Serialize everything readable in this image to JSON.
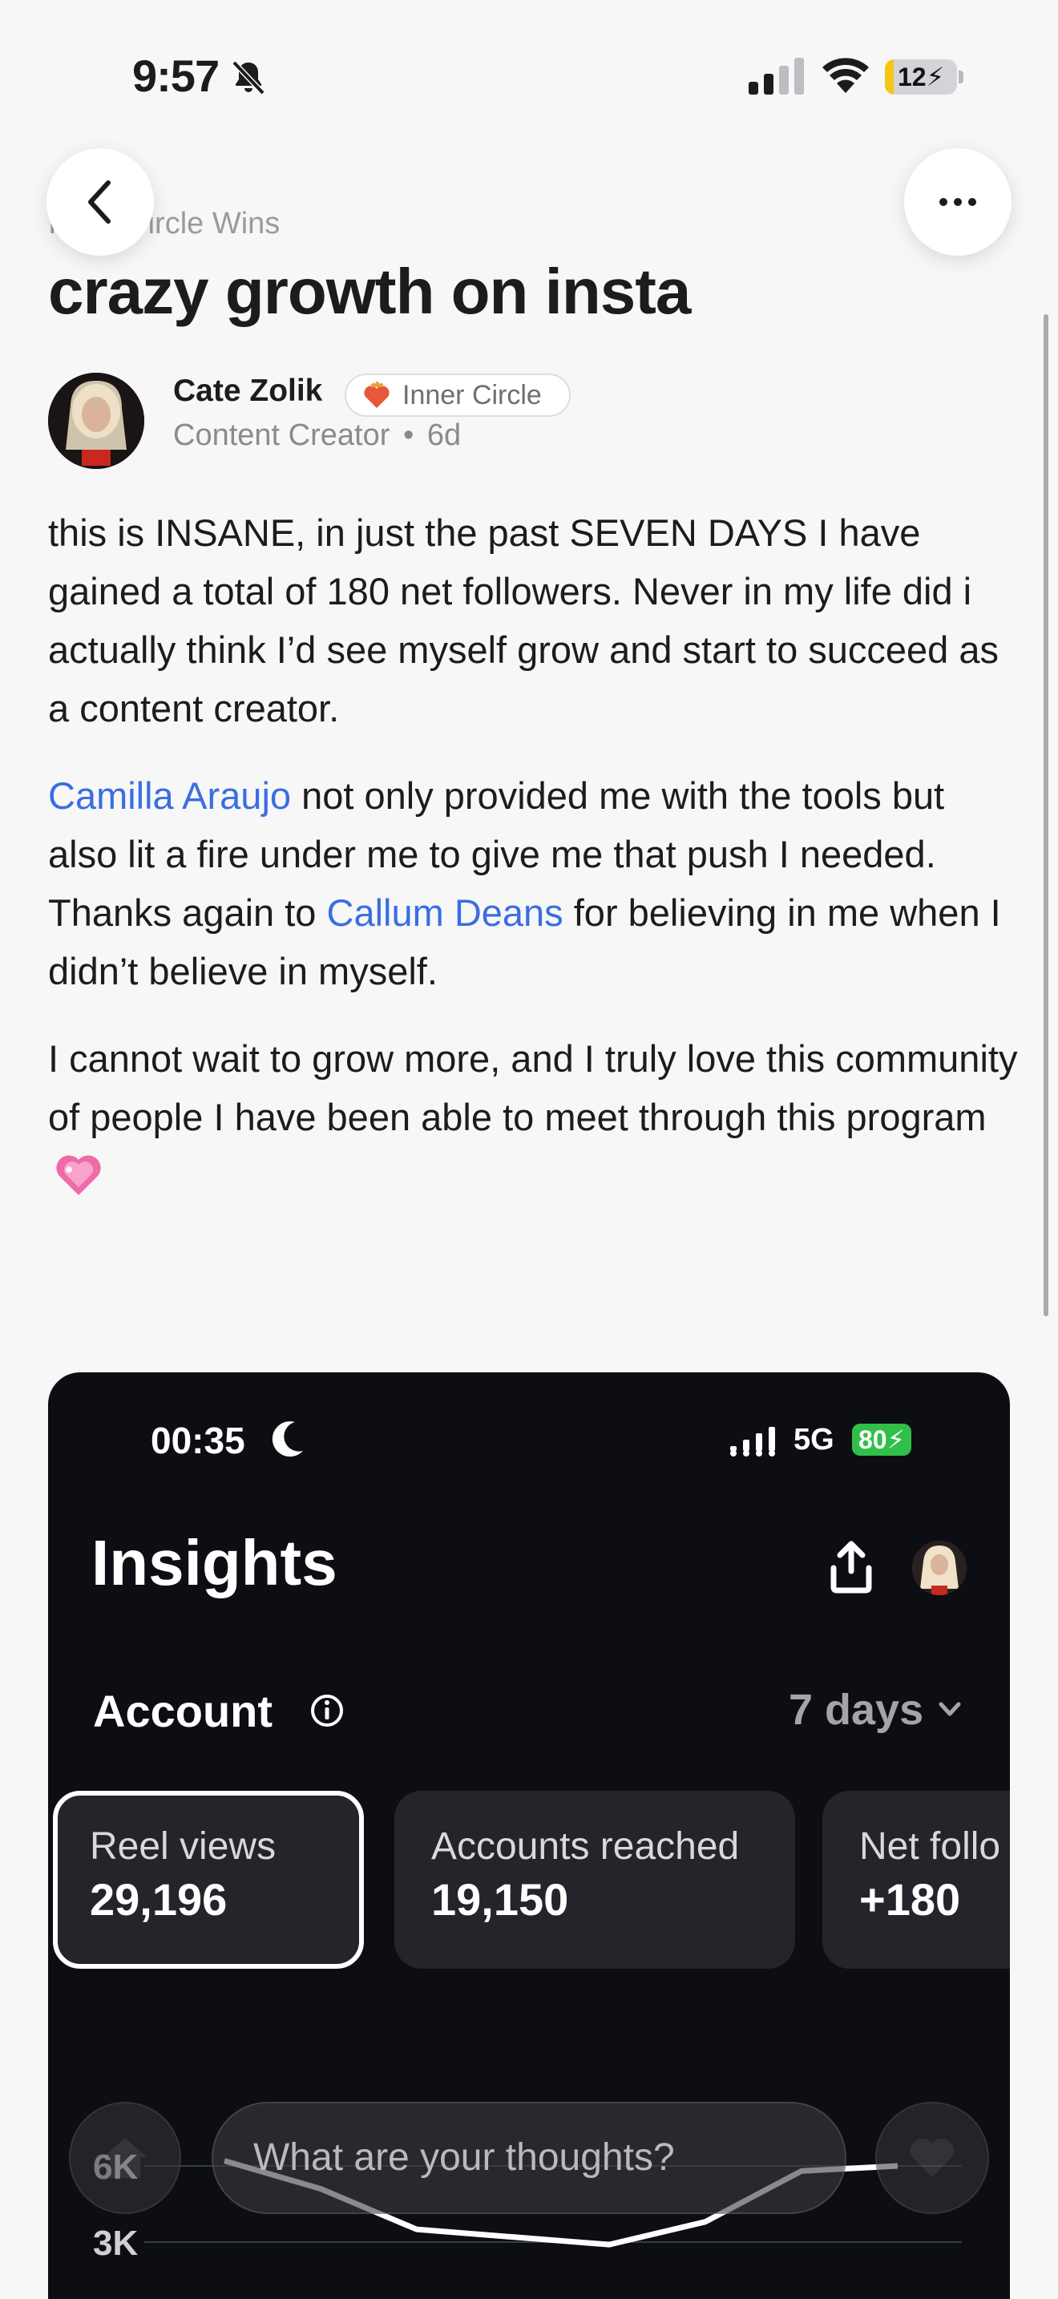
{
  "status_bar": {
    "time": "9:57",
    "battery": "12",
    "battery_level": 0.12,
    "icons": [
      "bell-slash-icon",
      "cellular-signal-icon",
      "wifi-icon",
      "battery-charging-icon"
    ]
  },
  "nav": {
    "back_icon": "chevron-left-icon",
    "more_icon": "ellipsis-icon"
  },
  "post": {
    "category": "Inner Circle Wins",
    "title": "crazy growth on insta",
    "author": {
      "name": "Cate Zolik",
      "badge": "Inner Circle",
      "role": "Content Creator",
      "age": "6d",
      "separator": "•"
    },
    "paragraphs": {
      "p1": "this is INSANE, in just the past SEVEN DAYS I have gained a total of 180 net followers. Never in my life did i actually think I’d see myself grow and start to succeed as a content creator.",
      "p2_mention1": "Camilla Araujo",
      "p2_text1": " not only provided me with the tools but also lit a fire under me to give me that push I needed. Thanks again to ",
      "p2_mention2": "Callum Deans",
      "p2_text2": " for believing in me when I didn’t believe in myself.",
      "p3": "I cannot wait to grow more, and I truly love this community of people I have been able to meet through this program"
    },
    "colors": {
      "mention": "#3a6ee0",
      "badge_icon": "#e8573a",
      "heart": "#f06aa8"
    }
  },
  "screenshot": {
    "time": "00:35",
    "network": "5G",
    "battery": "80",
    "title": "Insights",
    "account_label": "Account",
    "range": "7 days",
    "metrics": [
      {
        "label": "Reel views",
        "value": "29,196"
      },
      {
        "label": "Accounts reached",
        "value": "19,150"
      },
      {
        "label": "Net follo",
        "value": "+180"
      }
    ],
    "chart_data": {
      "type": "line",
      "title": "",
      "xlabel": "",
      "ylabel": "",
      "y_ticks": [
        "6K",
        "3K"
      ],
      "ylim": [
        0,
        6000
      ],
      "series": [
        {
          "values": [
            6200,
            5100,
            3500,
            3200,
            2900,
            3800,
            5800,
            6000
          ]
        }
      ],
      "grid": true
    }
  },
  "composer": {
    "placeholder": "What are your thoughts?",
    "home_icon": "home-icon",
    "like_icon": "heart-icon"
  }
}
